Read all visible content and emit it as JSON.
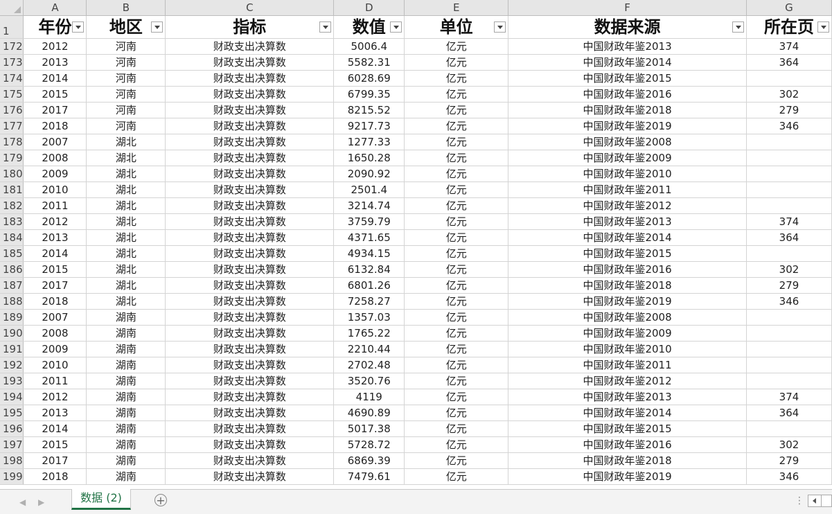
{
  "columns": [
    "A",
    "B",
    "C",
    "D",
    "E",
    "F",
    "G"
  ],
  "header_row": {
    "row_number": "1",
    "cells": [
      "年份",
      "地区",
      "指标",
      "数值",
      "单位",
      "数据来源",
      "所在页"
    ]
  },
  "rows": [
    {
      "n": "172",
      "c": [
        "2012",
        "河南",
        "财政支出决算数",
        "5006.4",
        "亿元",
        "中国财政年鉴2013",
        "374"
      ]
    },
    {
      "n": "173",
      "c": [
        "2013",
        "河南",
        "财政支出决算数",
        "5582.31",
        "亿元",
        "中国财政年鉴2014",
        "364"
      ]
    },
    {
      "n": "174",
      "c": [
        "2014",
        "河南",
        "财政支出决算数",
        "6028.69",
        "亿元",
        "中国财政年鉴2015",
        ""
      ]
    },
    {
      "n": "175",
      "c": [
        "2015",
        "河南",
        "财政支出决算数",
        "6799.35",
        "亿元",
        "中国财政年鉴2016",
        "302"
      ]
    },
    {
      "n": "176",
      "c": [
        "2017",
        "河南",
        "财政支出决算数",
        "8215.52",
        "亿元",
        "中国财政年鉴2018",
        "279"
      ]
    },
    {
      "n": "177",
      "c": [
        "2018",
        "河南",
        "财政支出决算数",
        "9217.73",
        "亿元",
        "中国财政年鉴2019",
        "346"
      ]
    },
    {
      "n": "178",
      "c": [
        "2007",
        "湖北",
        "财政支出决算数",
        "1277.33",
        "亿元",
        "中国财政年鉴2008",
        ""
      ]
    },
    {
      "n": "179",
      "c": [
        "2008",
        "湖北",
        "财政支出决算数",
        "1650.28",
        "亿元",
        "中国财政年鉴2009",
        ""
      ]
    },
    {
      "n": "180",
      "c": [
        "2009",
        "湖北",
        "财政支出决算数",
        "2090.92",
        "亿元",
        "中国财政年鉴2010",
        ""
      ]
    },
    {
      "n": "181",
      "c": [
        "2010",
        "湖北",
        "财政支出决算数",
        "2501.4",
        "亿元",
        "中国财政年鉴2011",
        ""
      ]
    },
    {
      "n": "182",
      "c": [
        "2011",
        "湖北",
        "财政支出决算数",
        "3214.74",
        "亿元",
        "中国财政年鉴2012",
        ""
      ]
    },
    {
      "n": "183",
      "c": [
        "2012",
        "湖北",
        "财政支出决算数",
        "3759.79",
        "亿元",
        "中国财政年鉴2013",
        "374"
      ]
    },
    {
      "n": "184",
      "c": [
        "2013",
        "湖北",
        "财政支出决算数",
        "4371.65",
        "亿元",
        "中国财政年鉴2014",
        "364"
      ]
    },
    {
      "n": "185",
      "c": [
        "2014",
        "湖北",
        "财政支出决算数",
        "4934.15",
        "亿元",
        "中国财政年鉴2015",
        ""
      ]
    },
    {
      "n": "186",
      "c": [
        "2015",
        "湖北",
        "财政支出决算数",
        "6132.84",
        "亿元",
        "中国财政年鉴2016",
        "302"
      ]
    },
    {
      "n": "187",
      "c": [
        "2017",
        "湖北",
        "财政支出决算数",
        "6801.26",
        "亿元",
        "中国财政年鉴2018",
        "279"
      ]
    },
    {
      "n": "188",
      "c": [
        "2018",
        "湖北",
        "财政支出决算数",
        "7258.27",
        "亿元",
        "中国财政年鉴2019",
        "346"
      ]
    },
    {
      "n": "189",
      "c": [
        "2007",
        "湖南",
        "财政支出决算数",
        "1357.03",
        "亿元",
        "中国财政年鉴2008",
        ""
      ]
    },
    {
      "n": "190",
      "c": [
        "2008",
        "湖南",
        "财政支出决算数",
        "1765.22",
        "亿元",
        "中国财政年鉴2009",
        ""
      ]
    },
    {
      "n": "191",
      "c": [
        "2009",
        "湖南",
        "财政支出决算数",
        "2210.44",
        "亿元",
        "中国财政年鉴2010",
        ""
      ]
    },
    {
      "n": "192",
      "c": [
        "2010",
        "湖南",
        "财政支出决算数",
        "2702.48",
        "亿元",
        "中国财政年鉴2011",
        ""
      ]
    },
    {
      "n": "193",
      "c": [
        "2011",
        "湖南",
        "财政支出决算数",
        "3520.76",
        "亿元",
        "中国财政年鉴2012",
        ""
      ]
    },
    {
      "n": "194",
      "c": [
        "2012",
        "湖南",
        "财政支出决算数",
        "4119",
        "亿元",
        "中国财政年鉴2013",
        "374"
      ]
    },
    {
      "n": "195",
      "c": [
        "2013",
        "湖南",
        "财政支出决算数",
        "4690.89",
        "亿元",
        "中国财政年鉴2014",
        "364"
      ]
    },
    {
      "n": "196",
      "c": [
        "2014",
        "湖南",
        "财政支出决算数",
        "5017.38",
        "亿元",
        "中国财政年鉴2015",
        ""
      ]
    },
    {
      "n": "197",
      "c": [
        "2015",
        "湖南",
        "财政支出决算数",
        "5728.72",
        "亿元",
        "中国财政年鉴2016",
        "302"
      ]
    },
    {
      "n": "198",
      "c": [
        "2017",
        "湖南",
        "财政支出决算数",
        "6869.39",
        "亿元",
        "中国财政年鉴2018",
        "279"
      ]
    },
    {
      "n": "199",
      "c": [
        "2018",
        "湖南",
        "财政支出决算数",
        "7479.61",
        "亿元",
        "中国财政年鉴2019",
        "346"
      ]
    }
  ],
  "sheet_tabs": [
    "数据 (2)"
  ],
  "add_sheet_symbol": "+",
  "accent_color": "#217346"
}
